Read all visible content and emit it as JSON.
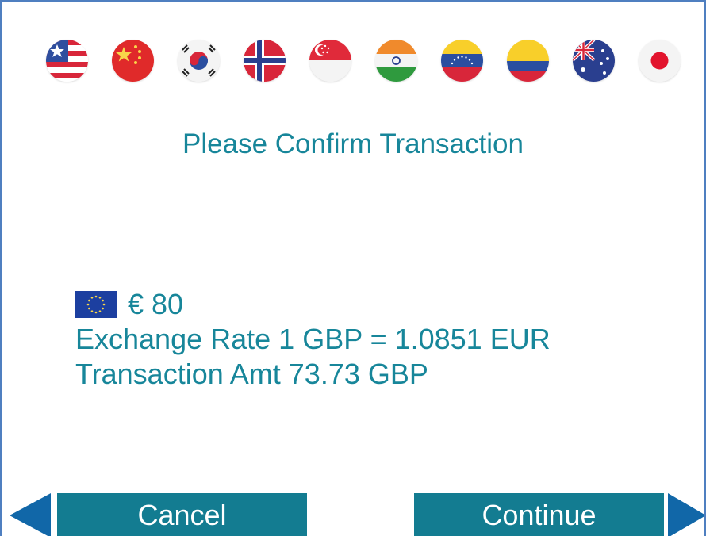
{
  "flags": [
    {
      "icon": "us-flag-icon"
    },
    {
      "icon": "china-flag-icon"
    },
    {
      "icon": "south-korea-flag-icon"
    },
    {
      "icon": "norway-flag-icon"
    },
    {
      "icon": "singapore-flag-icon"
    },
    {
      "icon": "india-flag-icon"
    },
    {
      "icon": "venezuela-flag-icon"
    },
    {
      "icon": "colombia-flag-icon"
    },
    {
      "icon": "australia-flag-icon"
    },
    {
      "icon": "japan-flag-icon"
    }
  ],
  "screen": {
    "title": "Please Confirm Transaction"
  },
  "transaction": {
    "currency_icon": "eu-flag-icon",
    "amount": "€ 80",
    "exchange_rate": "Exchange Rate 1  GBP = 1.0851 EUR",
    "transaction_amount": "Transaction Amt 73.73 GBP"
  },
  "buttons": {
    "cancel_label": "Cancel",
    "continue_label": "Continue"
  },
  "colors": {
    "accent": "#137c91",
    "text": "#17869a",
    "frame": "#4f7fc0",
    "arrow": "#1167a8"
  }
}
